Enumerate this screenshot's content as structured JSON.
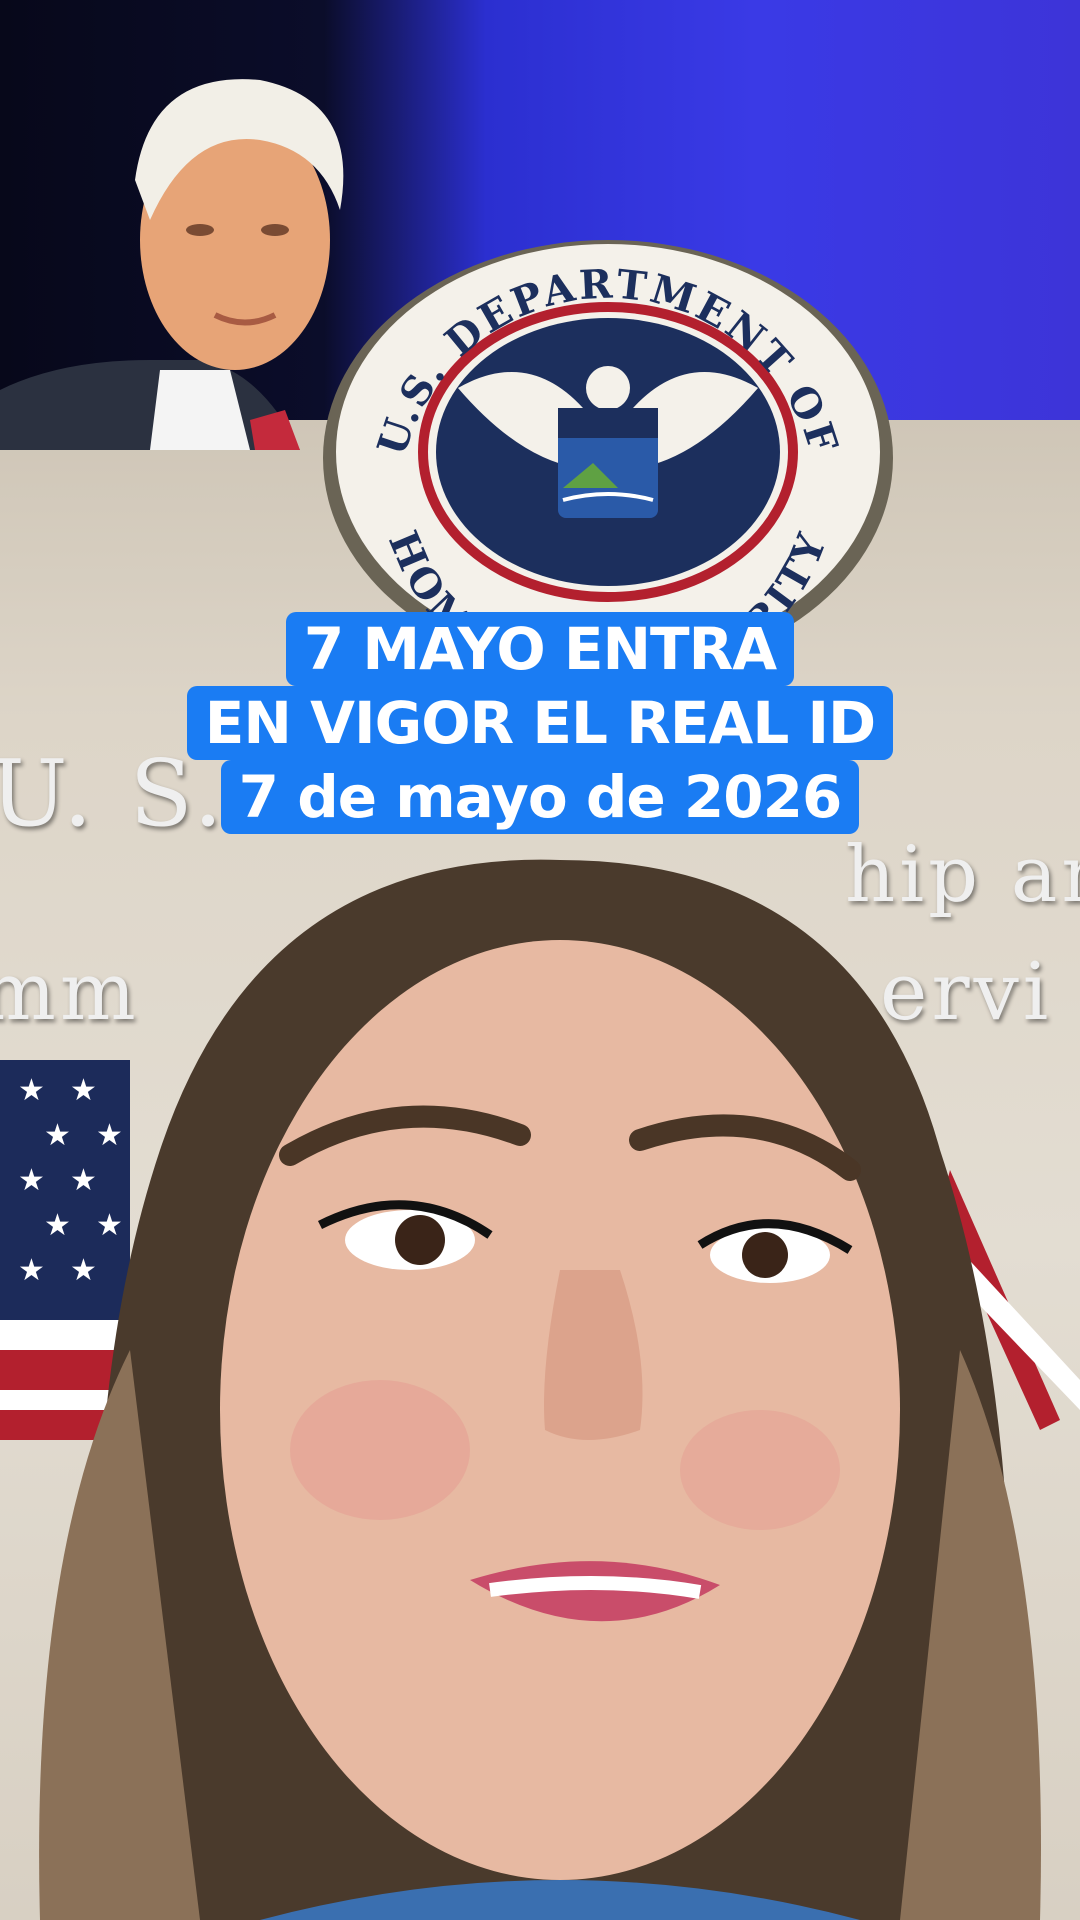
{
  "caption": {
    "line1": "7 MAYO ENTRA",
    "line2": "EN VIGOR EL REAL ID",
    "line3": "7 de mayo de 2026"
  },
  "seal": {
    "top_text": "U.S. DEPARTMENT OF",
    "bottom_text": "HOMELAND SECURITY"
  },
  "wall": {
    "line1_left": "U. S.",
    "line1_right": "hip an",
    "line2_left": "mm",
    "line2_right": "ervi"
  },
  "colors": {
    "caption_bg": "#1a7cf3",
    "caption_text": "#ffffff"
  }
}
